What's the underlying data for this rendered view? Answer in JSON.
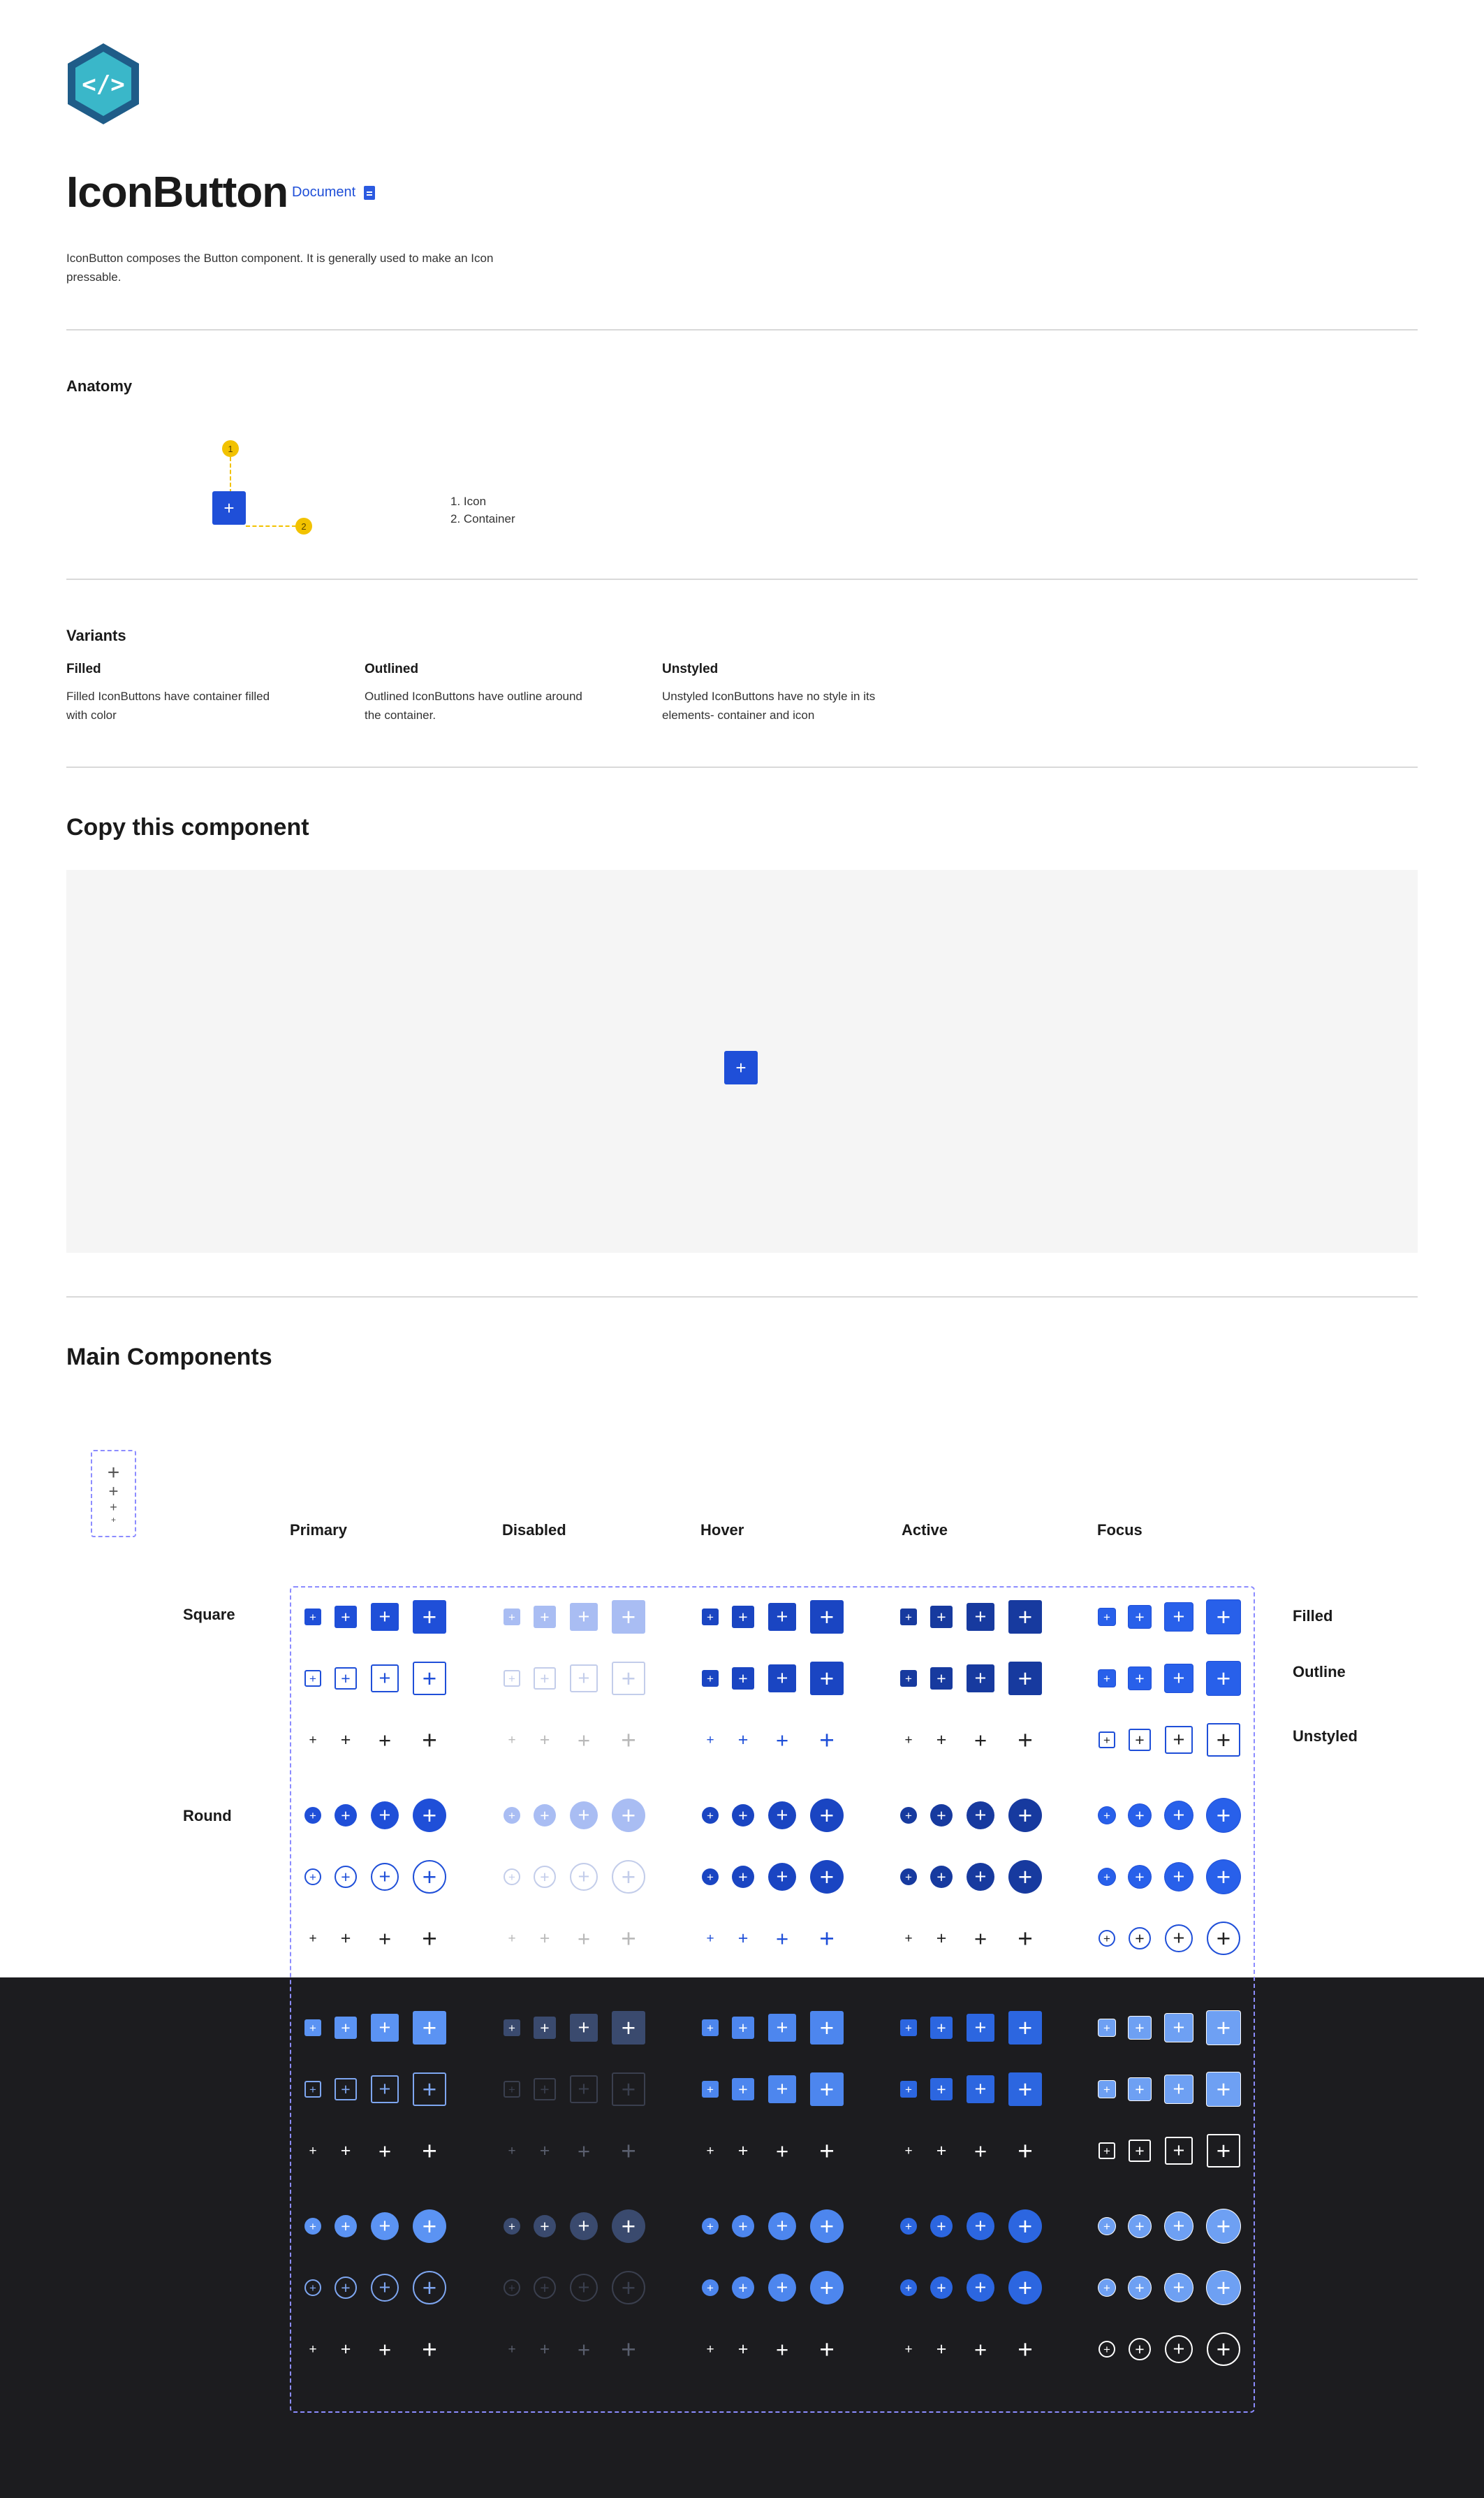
{
  "header": {
    "title": "IconButton",
    "doc_link": "Document",
    "intro": "IconButton composes the Button component. It is generally used to make an Icon pressable."
  },
  "anatomy": {
    "heading": "Anatomy",
    "callout_1": "1",
    "callout_2": "2",
    "button_icon": "+",
    "legend_1": "1. Icon",
    "legend_2": "2. Container"
  },
  "variants": {
    "heading": "Variants",
    "items": [
      {
        "title": "Filled",
        "desc": "Filled IconButtons have container filled with color"
      },
      {
        "title": "Outlined",
        "desc": "Outlined IconButtons have outline around the container."
      },
      {
        "title": "Unstyled",
        "desc": "Unstyled IconButtons have no style in its elements- container and icon"
      }
    ]
  },
  "copy": {
    "heading": "Copy this component",
    "button_icon": "+"
  },
  "main": {
    "heading": "Main Components",
    "props_icons": [
      "+",
      "+",
      "+",
      "+"
    ],
    "columns": [
      "Primary",
      "Disabled",
      "Hover",
      "Active",
      "Focus"
    ],
    "shape_labels": [
      "Square",
      "Round"
    ],
    "variant_labels": [
      "Filled",
      "Outline",
      "Unstyled"
    ],
    "glyph": "+"
  },
  "colors": {
    "accent": "#1f4fd8",
    "callout": "#f2c200",
    "dark_bg": "#1c1c1f",
    "frame_dash": "#8c8cff"
  }
}
